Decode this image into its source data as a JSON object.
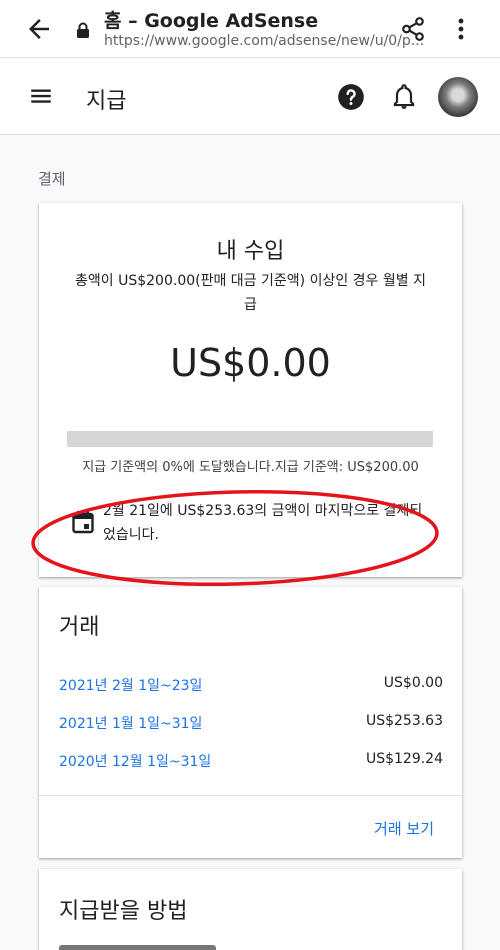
{
  "browser": {
    "tab_title": "홈 – Google AdSense",
    "url": "https://www.google.com/adsense/new/u/0/p..."
  },
  "app_bar": {
    "title": "지급"
  },
  "section_label": "결제",
  "earnings": {
    "title": "내 수입",
    "description": "총액이 US$200.00(판매 대금 기준액) 이상인 경우 월별 지급",
    "amount": "US$0.00",
    "progress_percent": 0,
    "threshold_text": "지급 기준액의 0%에 도달했습니다.지급 기준액: US$200.00",
    "last_payment_text": "2월 21일에 US$253.63의 금액이 마지막으로 결제되었습니다."
  },
  "transactions": {
    "title": "거래",
    "rows": [
      {
        "period": "2021년 2월 1일~23일",
        "amount": "US$0.00"
      },
      {
        "period": "2021년 1월 1일~31일",
        "amount": "US$253.63"
      },
      {
        "period": "2020년 12월 1일~31일",
        "amount": "US$129.24"
      }
    ],
    "view_label": "거래 보기"
  },
  "payment_method": {
    "title": "지급받을 방법"
  },
  "colors": {
    "link": "#1a73e8",
    "annotation": "#e4141b"
  }
}
